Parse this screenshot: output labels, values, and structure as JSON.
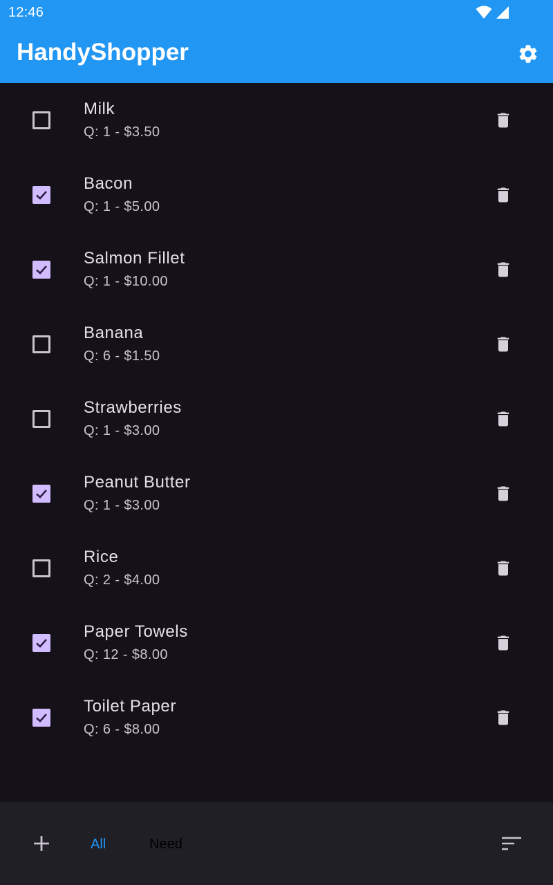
{
  "status_bar": {
    "time": "12:46",
    "icons": [
      "wifi-icon",
      "cell-signal-icon"
    ]
  },
  "app_bar": {
    "title": "HandyShopper",
    "actions": [
      "settings-icon"
    ],
    "color": "#2196f3"
  },
  "items": [
    {
      "name": "Milk",
      "detail": "Q: 1 - $3.50",
      "checked": false
    },
    {
      "name": "Bacon",
      "detail": "Q: 1 - $5.00",
      "checked": true
    },
    {
      "name": "Salmon Fillet",
      "detail": "Q: 1 - $10.00",
      "checked": true
    },
    {
      "name": "Banana",
      "detail": "Q: 6 - $1.50",
      "checked": false
    },
    {
      "name": "Strawberries",
      "detail": "Q: 1 - $3.00",
      "checked": false
    },
    {
      "name": "Peanut Butter",
      "detail": "Q: 1 - $3.00",
      "checked": true
    },
    {
      "name": "Rice",
      "detail": "Q: 2 - $4.00",
      "checked": false
    },
    {
      "name": "Paper Towels",
      "detail": "Q: 12 - $8.00",
      "checked": true
    },
    {
      "name": "Toilet Paper",
      "detail": "Q: 6 - $8.00",
      "checked": true
    }
  ],
  "bottom_bar": {
    "add_icon": "plus-icon",
    "filter_all": "All",
    "filter_need": "Need",
    "active_filter": "All",
    "sort_icon": "sort-icon"
  },
  "colors": {
    "accent": "#2196f3",
    "checkbox_checked": "#d0bcff",
    "background": "#141218",
    "bottom_bar": "#211f26"
  }
}
